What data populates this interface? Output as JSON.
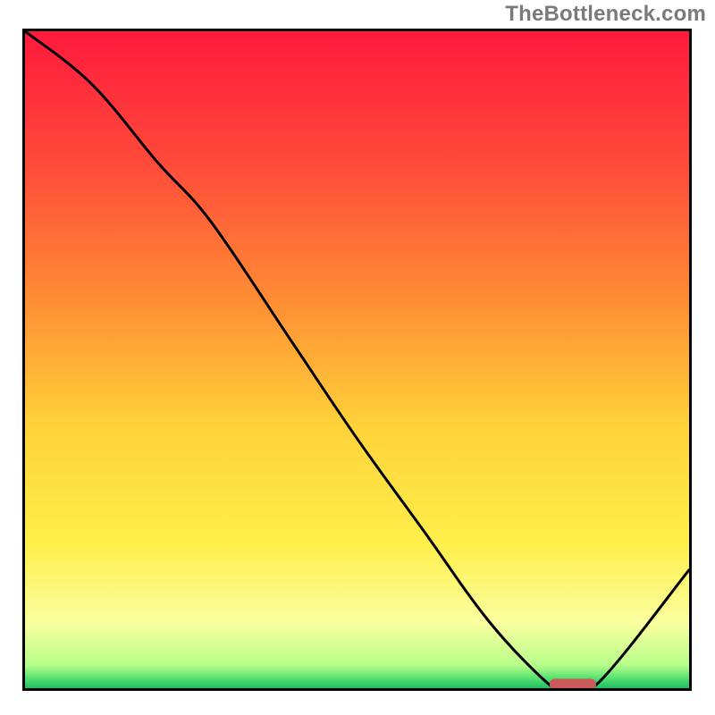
{
  "watermark": "TheBottleneck.com",
  "chart_data": {
    "type": "line",
    "title": "",
    "xlabel": "",
    "ylabel": "",
    "xlim": [
      0,
      100
    ],
    "ylim": [
      0,
      100
    ],
    "grid": false,
    "legend": false,
    "annotations": [],
    "series": [
      {
        "name": "bottleneck-curve",
        "x": [
          0,
          10,
          20,
          28,
          40,
          50,
          60,
          70,
          79,
          81,
          86,
          100
        ],
        "values": [
          100,
          92,
          80,
          71,
          53,
          38,
          24,
          10,
          0.5,
          0.5,
          0.5,
          18
        ]
      }
    ],
    "optimal_marker": {
      "x_start": 79,
      "x_end": 86,
      "y": 0.5,
      "color": "#c85a5a"
    },
    "gradient_stops": [
      {
        "offset": 0.0,
        "color": "#ff1a3d"
      },
      {
        "offset": 0.2,
        "color": "#ff4a3a"
      },
      {
        "offset": 0.4,
        "color": "#ff8a34"
      },
      {
        "offset": 0.6,
        "color": "#ffd23a"
      },
      {
        "offset": 0.78,
        "color": "#ffef4a"
      },
      {
        "offset": 0.9,
        "color": "#fbffa0"
      },
      {
        "offset": 0.965,
        "color": "#b7ff8a"
      },
      {
        "offset": 0.985,
        "color": "#55e070"
      },
      {
        "offset": 1.0,
        "color": "#1fbf62"
      }
    ]
  }
}
